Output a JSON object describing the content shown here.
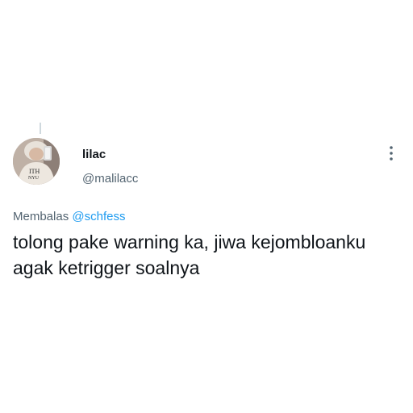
{
  "tweet": {
    "display_name": "lilac",
    "handle": "@malilacc",
    "reply_prefix": "Membalas",
    "reply_mention": "@schfess",
    "text": "tolong pake warning ka, jiwa kejombloanku agak ketrigger soalnya"
  },
  "colors": {
    "primary_text": "#0f1419",
    "secondary_text": "#536471",
    "link": "#1d9bf0",
    "thread_line": "#cfd9de"
  },
  "icons": {
    "more": "more-vertical-icon",
    "avatar": "avatar"
  }
}
